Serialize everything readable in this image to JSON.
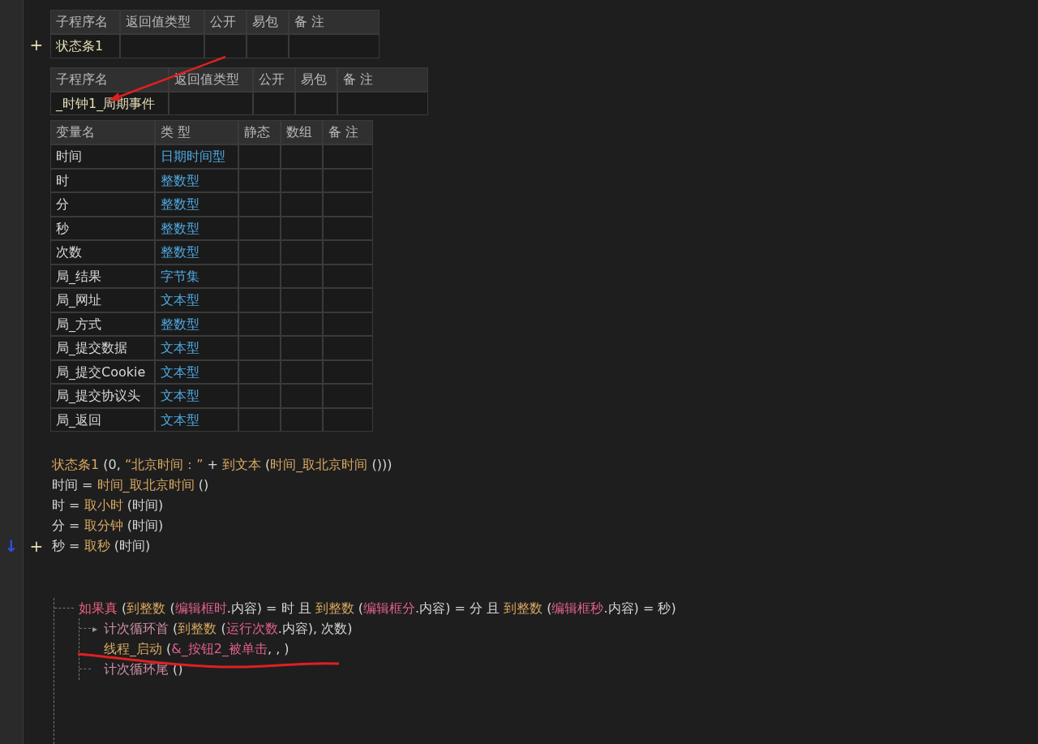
{
  "subroutine_tables": [
    {
      "gutter_mark": "+",
      "columns": [
        "子程序名",
        "返回值类型",
        "公开",
        "易包",
        "备 注"
      ],
      "name": "状态条1"
    },
    {
      "columns": [
        "子程序名",
        "返回值类型",
        "公开",
        "易包",
        "备 注"
      ],
      "name": "_时钟1_周期事件"
    }
  ],
  "variables": {
    "columns": [
      "变量名",
      "类 型",
      "静态",
      "数组",
      "备 注"
    ],
    "rows": [
      {
        "name": "时间",
        "type": "日期时间型"
      },
      {
        "name": "时",
        "type": "整数型"
      },
      {
        "name": "分",
        "type": "整数型"
      },
      {
        "name": "秒",
        "type": "整数型"
      },
      {
        "name": "次数",
        "type": "整数型"
      },
      {
        "name": "局_结果",
        "type": "字节集"
      },
      {
        "name": "局_网址",
        "type": "文本型"
      },
      {
        "name": "局_方式",
        "type": "整数型"
      },
      {
        "name": "局_提交数据",
        "type": "文本型"
      },
      {
        "name": "局_提交Cookie",
        "type": "文本型"
      },
      {
        "name": "局_提交协议头",
        "type": "文本型"
      },
      {
        "name": "局_返回",
        "type": "文本型"
      }
    ]
  },
  "code_lines": [
    {
      "tokens": [
        {
          "text": "状态条1",
          "kind": "func"
        },
        {
          "text": " (0, ",
          "kind": "plain"
        },
        {
          "text": "“北京时间：”",
          "kind": "func"
        },
        {
          "text": " + ",
          "kind": "plain"
        },
        {
          "text": "到文本",
          "kind": "func"
        },
        {
          "text": " (",
          "kind": "plain"
        },
        {
          "text": "时间_取北京时间",
          "kind": "func"
        },
        {
          "text": " ()))",
          "kind": "plain"
        }
      ]
    },
    {
      "tokens": [
        {
          "text": "时间 = ",
          "kind": "plain"
        },
        {
          "text": "时间_取北京时间",
          "kind": "func"
        },
        {
          "text": " ()",
          "kind": "plain"
        }
      ]
    },
    {
      "tokens": [
        {
          "text": "时 = ",
          "kind": "plain"
        },
        {
          "text": "取小时",
          "kind": "func"
        },
        {
          "text": " (时间)",
          "kind": "plain"
        }
      ]
    },
    {
      "tokens": [
        {
          "text": "分 = ",
          "kind": "plain"
        },
        {
          "text": "取分钟",
          "kind": "func"
        },
        {
          "text": " (时间)",
          "kind": "plain"
        }
      ]
    },
    {
      "breakpoint_mark": "↓",
      "gutter_mark": "+",
      "tokens": [
        {
          "text": "秒 = ",
          "kind": "plain"
        },
        {
          "text": "取秒",
          "kind": "func"
        },
        {
          "text": " (时间)",
          "kind": "plain"
        }
      ]
    }
  ],
  "if_block": {
    "tokens": [
      {
        "text": "如果真",
        "kind": "flow"
      },
      {
        "text": " (",
        "kind": "plain"
      },
      {
        "text": "到整数",
        "kind": "func"
      },
      {
        "text": " (",
        "kind": "plain"
      },
      {
        "text": "编辑框时",
        "kind": "ctrl"
      },
      {
        "text": ".内容) = 时 且 ",
        "kind": "plain"
      },
      {
        "text": "到整数",
        "kind": "func"
      },
      {
        "text": " (",
        "kind": "plain"
      },
      {
        "text": "编辑框分",
        "kind": "ctrl"
      },
      {
        "text": ".内容) = 分 且 ",
        "kind": "plain"
      },
      {
        "text": "到整数",
        "kind": "func"
      },
      {
        "text": " (",
        "kind": "plain"
      },
      {
        "text": "编辑框秒",
        "kind": "ctrl"
      },
      {
        "text": ".内容) = 秒)",
        "kind": "plain"
      }
    ],
    "children": [
      {
        "loop_marker": "▸",
        "tokens": [
          {
            "text": "计次循环首",
            "kind": "loop"
          },
          {
            "text": " (",
            "kind": "plain"
          },
          {
            "text": "到整数",
            "kind": "func"
          },
          {
            "text": " (",
            "kind": "plain"
          },
          {
            "text": "运行次数",
            "kind": "ctrl"
          },
          {
            "text": ".内容), 次数)",
            "kind": "plain"
          }
        ]
      },
      {
        "tokens": [
          {
            "text": "线程_启动",
            "kind": "func"
          },
          {
            "text": " (",
            "kind": "plain"
          },
          {
            "text": "&_按钮2_被单击",
            "kind": "ctrl"
          },
          {
            "text": ", , )",
            "kind": "plain"
          }
        ]
      },
      {
        "tokens": [
          {
            "text": "计次循环尾",
            "kind": "loop"
          },
          {
            "text": " ()",
            "kind": "plain"
          }
        ]
      }
    ]
  }
}
